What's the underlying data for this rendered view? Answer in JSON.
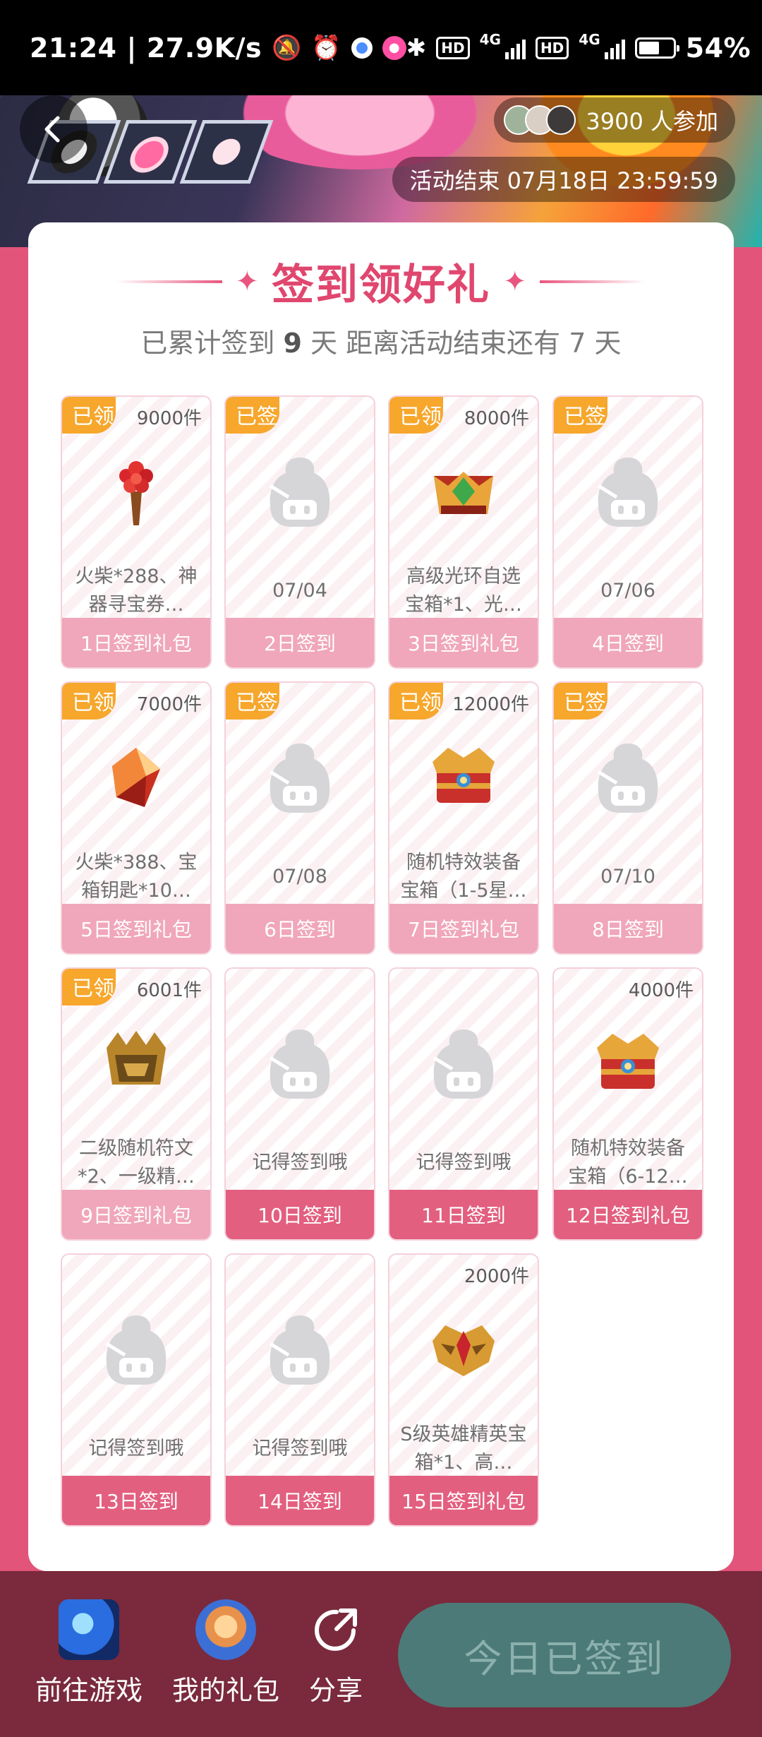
{
  "status_bar": {
    "time": "21:24",
    "net_speed": "27.9K/s",
    "hd_label": "HD",
    "net_type": "4G",
    "battery": "54%"
  },
  "header": {
    "participants": "3900 人参加",
    "end_time": "活动结束 07月18日 23:59:59"
  },
  "card": {
    "title": "签到领好礼",
    "subtitle_prefix": "已累计签到",
    "signed_days": "9",
    "subtitle_mid": "天  距离活动结束还有",
    "remaining_days": "7",
    "subtitle_suffix": "天"
  },
  "tiles": [
    {
      "corner": "已领",
      "count": "9000件",
      "desc": "火柴*288、神器寻宝券…",
      "label": "1日签到礼包",
      "icon": "torch-icon"
    },
    {
      "corner": "已签",
      "count": "",
      "desc": "07/04",
      "label": "2日签到",
      "icon": "placeholder-icon"
    },
    {
      "corner": "已领",
      "count": "8000件",
      "desc": "高级光环自选宝箱*1、光…",
      "label": "3日签到礼包",
      "icon": "crown-icon"
    },
    {
      "corner": "已签",
      "count": "",
      "desc": "07/06",
      "label": "4日签到",
      "icon": "placeholder-icon"
    },
    {
      "corner": "已领",
      "count": "7000件",
      "desc": "火柴*388、宝箱钥匙*10…",
      "label": "5日签到礼包",
      "icon": "gem-icon"
    },
    {
      "corner": "已签",
      "count": "",
      "desc": "07/08",
      "label": "6日签到",
      "icon": "placeholder-icon"
    },
    {
      "corner": "已领",
      "count": "12000件",
      "desc": "随机特效装备宝箱（1-5星…",
      "label": "7日签到礼包",
      "icon": "chest-icon"
    },
    {
      "corner": "已签",
      "count": "",
      "desc": "07/10",
      "label": "8日签到",
      "icon": "placeholder-icon"
    },
    {
      "corner": "已领",
      "count": "6001件",
      "desc": "二级随机符文*2、一级精…",
      "label": "9日签到礼包",
      "icon": "helmet-icon"
    },
    {
      "corner": "",
      "count": "",
      "desc": "记得签到哦",
      "label": "10日签到",
      "icon": "placeholder-icon"
    },
    {
      "corner": "",
      "count": "",
      "desc": "记得签到哦",
      "label": "11日签到",
      "icon": "placeholder-icon"
    },
    {
      "corner": "",
      "count": "4000件",
      "desc": "随机特效装备宝箱（6-12…",
      "label": "12日签到礼包",
      "icon": "chest-icon"
    },
    {
      "corner": "",
      "count": "",
      "desc": "记得签到哦",
      "label": "13日签到",
      "icon": "placeholder-icon"
    },
    {
      "corner": "",
      "count": "",
      "desc": "记得签到哦",
      "label": "14日签到",
      "icon": "placeholder-icon"
    },
    {
      "corner": "",
      "count": "2000件",
      "desc": "S级英雄精英宝箱*1、高…",
      "label": "15日签到礼包",
      "icon": "mask-icon"
    }
  ],
  "bottom_bar": {
    "go_game": "前往游戏",
    "my_gifts": "我的礼包",
    "share": "分享",
    "signed_button": "今日已签到"
  }
}
